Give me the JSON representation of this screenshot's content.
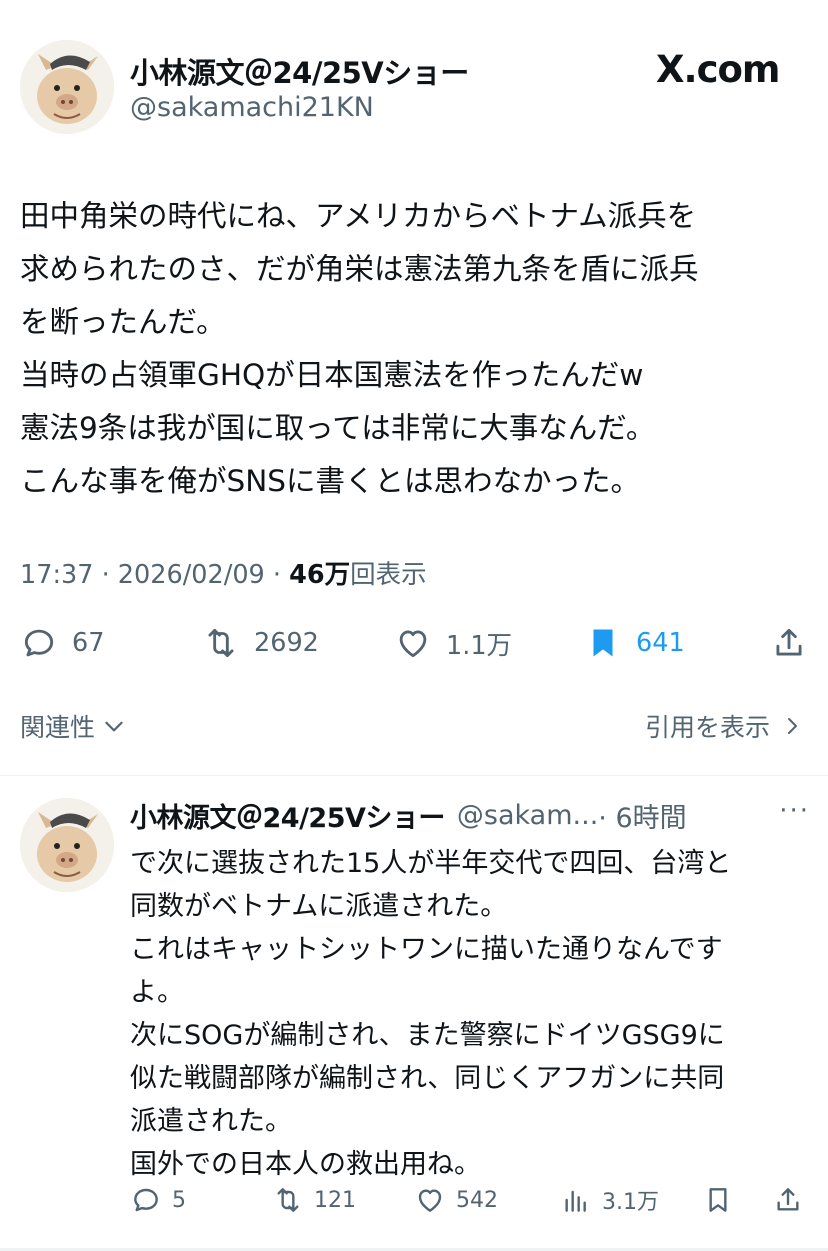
{
  "main_tweet": {
    "author_name": "小林源文＠24/25Vショー",
    "author_handle": "@sakamachi21KN",
    "brand": "X.com",
    "body_lines": [
      "田中角栄の時代にね、アメリカからベトナム派兵を",
      "求められたのさ、だが角栄は憲法第九条を盾に派兵",
      "を断ったんだ。",
      "当時の占領軍GHQが日本国憲法を作ったんだw",
      "憲法9条は我が国に取っては非常に大事なんだ。",
      "こんな事を俺がSNSに書くとは思わなかった。"
    ],
    "time": "17:37 · 2026/02/09 · ",
    "views_count": "46万",
    "views_label": "回表示",
    "replies": "67",
    "retweets": "2692",
    "likes": "1.1万",
    "bookmarks": "641",
    "related_label": "関連性",
    "quotes_label": "引用を表示"
  },
  "reply_tweet": {
    "author_name": "小林源文＠24/25Vショー",
    "author_handle": "@sakam...",
    "time": "· 6時間",
    "more": "···",
    "body_lines": [
      "で次に選抜された15人が半年交代で四回、台湾と",
      "同数がベトナムに派遣された。",
      "これはキャットシットワンに描いた通りなんです",
      "よ。",
      "次にSOGが編制され、また警察にドイツGSG9に",
      "似た戦闘部隊が編制され、同じくアフガンに共同",
      "派遣された。",
      "国外での日本人の救出用ね。"
    ],
    "replies": "5",
    "retweets": "121",
    "likes": "542",
    "views": "3.1万"
  },
  "colors": {
    "text": "#0f1419",
    "muted": "#536471",
    "bookmark_active": "#1d9bf0",
    "divider": "#eff3f4"
  },
  "icons": {
    "reply": "reply-icon",
    "retweet": "retweet-icon",
    "like": "heart-icon",
    "bookmark": "bookmark-icon",
    "share": "share-icon",
    "views": "analytics-icon",
    "avatar": "pig-avatar"
  }
}
